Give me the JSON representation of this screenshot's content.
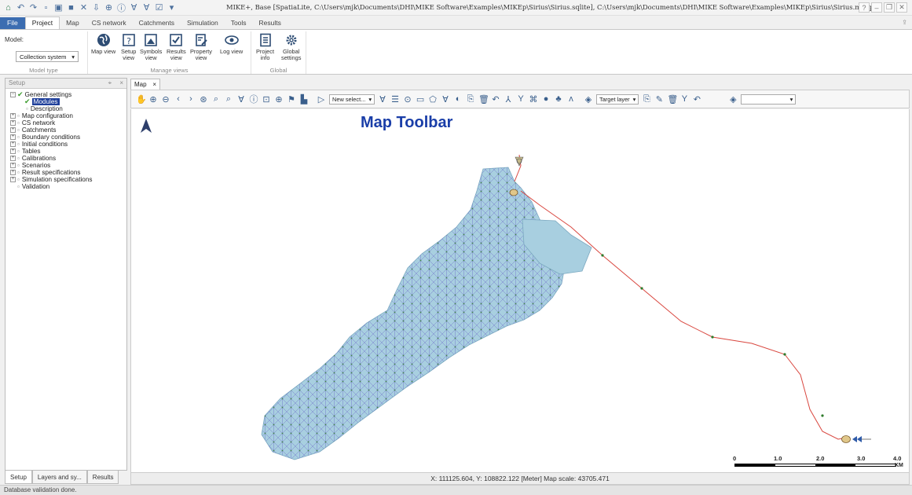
{
  "window": {
    "title": "MIKE+, Base [SpatiaLite, C:\\Users\\mjk\\Documents\\DHI\\MIKE Software\\Examples\\MIKEp\\Sirius\\Sirius.sqlite], C:\\Users\\mjk\\Documents\\DHI\\MIKE Software\\Examples\\MIKEp\\Sirius\\Sirius.mupp"
  },
  "ribbon_tabs": [
    "File",
    "Project",
    "Map",
    "CS network",
    "Catchments",
    "Simulation",
    "Tools",
    "Results"
  ],
  "ribbon": {
    "model_label": "Model:",
    "model_value": "Collection system",
    "model_group": "Model type",
    "manage_group": "Manage views",
    "global_group": "Global",
    "map_view": "Map view",
    "setup_view_1": "Setup",
    "setup_view_2": "view",
    "symbols_view_1": "Symbols",
    "symbols_view_2": "view",
    "results_view_1": "Results",
    "results_view_2": "view",
    "property_view_1": "Property",
    "property_view_2": "view",
    "log_view": "Log view",
    "project_info_1": "Project",
    "project_info_2": "info",
    "global_settings_1": "Global",
    "global_settings_2": "settings"
  },
  "setup_panel": {
    "title": "Setup",
    "pin": "⌂",
    "close": "×",
    "tree": [
      "General settings",
      "Modules",
      "Description",
      "Map configuration",
      "CS network",
      "Catchments",
      "Boundary conditions",
      "Initial conditions",
      "Tables",
      "Calibrations",
      "Scenarios",
      "Result specifications",
      "Simulation specifications",
      "Validation"
    ]
  },
  "bottom_tabs": [
    "Setup",
    "Layers and sy...",
    "Results"
  ],
  "map": {
    "tab_label": "Map",
    "heading": "Map Toolbar",
    "select_label": "New select...",
    "target_layer": "Target layer",
    "scale_labels": [
      "0",
      "1.0",
      "2.0",
      "3.0",
      "4.0"
    ],
    "scale_unit": "KM",
    "coordinates": "X: 111125.604, Y: 108822.122 [Meter]   Map scale: 43705.471"
  },
  "status": "Database validation done.",
  "colors": {
    "file_tab": "#3c6db1",
    "catchment_fill": "#a8cfe0",
    "network_link": "#6a63c8",
    "network_node": "#2d7a2a",
    "pipe_red": "#d9473f",
    "heading_blue": "#1a3ea8"
  }
}
